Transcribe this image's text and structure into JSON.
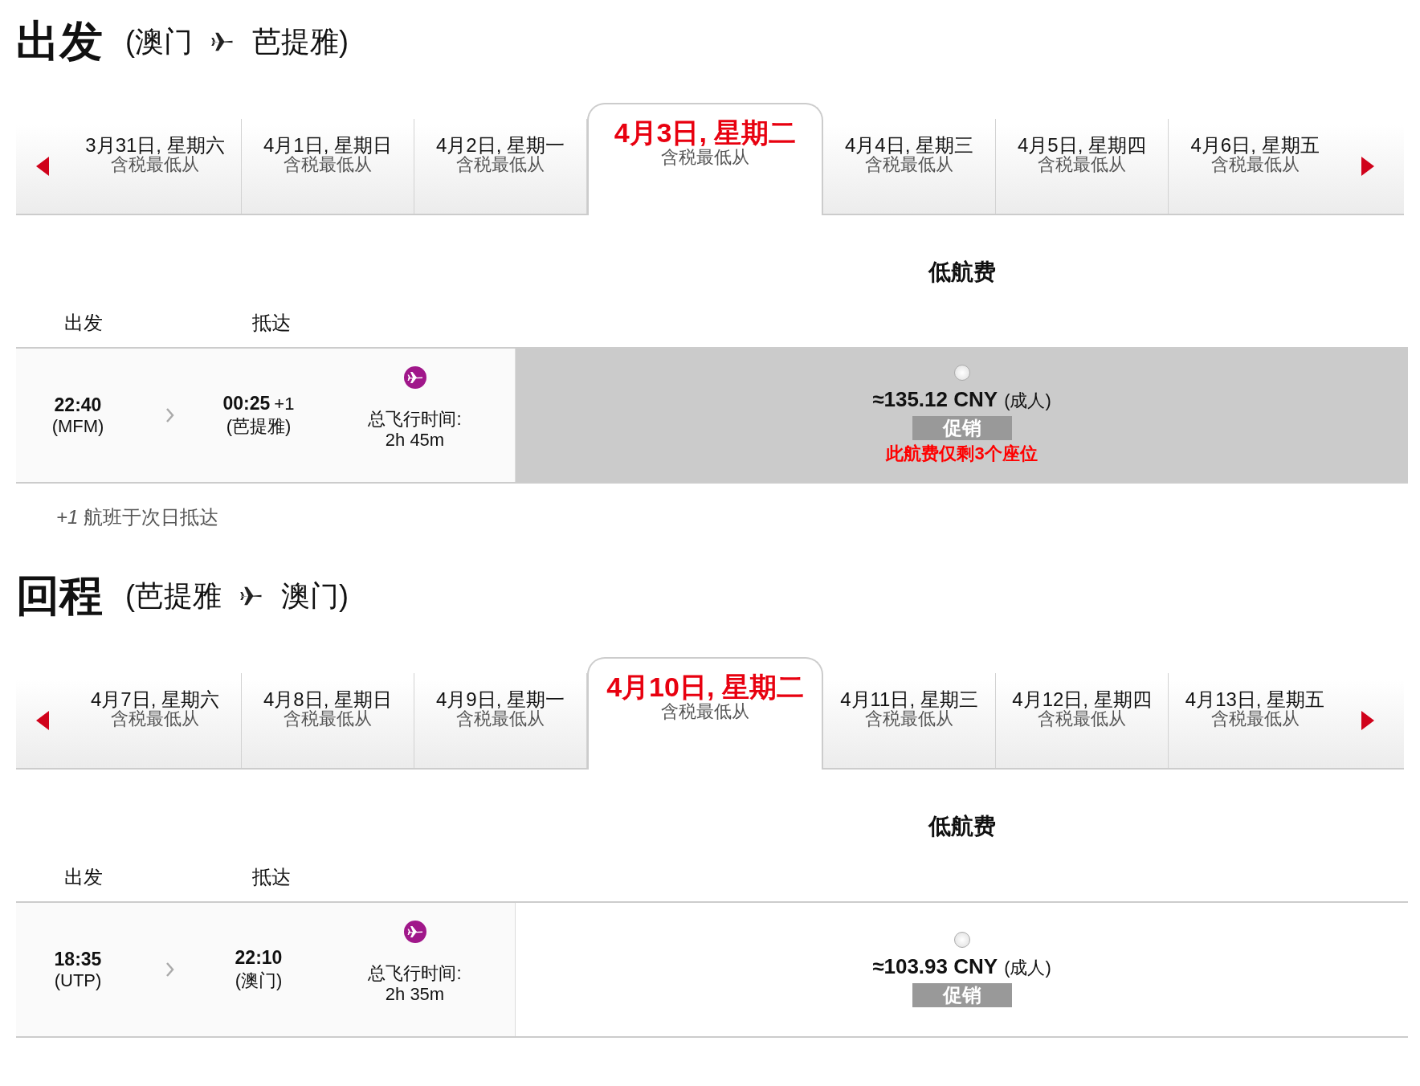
{
  "sections": [
    {
      "title": "出发",
      "route_from": "(澳门",
      "route_to": "芭提雅)",
      "dates": [
        {
          "date": "3月31日, 星期六",
          "sub": "含税最低从",
          "selected": false
        },
        {
          "date": "4月1日, 星期日",
          "sub": "含税最低从",
          "selected": false
        },
        {
          "date": "4月2日, 星期一",
          "sub": "含税最低从",
          "selected": false
        },
        {
          "date": "4月3日, 星期二",
          "sub": "含税最低从",
          "selected": true
        },
        {
          "date": "4月4日, 星期三",
          "sub": "含税最低从",
          "selected": false
        },
        {
          "date": "4月5日, 星期四",
          "sub": "含税最低从",
          "selected": false
        },
        {
          "date": "4月6日, 星期五",
          "sub": "含税最低从",
          "selected": false
        }
      ],
      "fare_header": "低航费",
      "col_depart": "出发",
      "col_arrive": "抵达",
      "flight": {
        "dep_time": "22:40",
        "dep_code": "(MFM)",
        "arr_time": "00:25",
        "arr_plus": "+1",
        "arr_place": "(芭提雅)",
        "duration_label": "总飞行时间:",
        "duration": "2h 45m",
        "fare": {
          "price": "≈135.12 CNY",
          "pax": "(成人)",
          "badge": "促销",
          "warning": "此航费仅剩3个座位",
          "highlighted": true,
          "checked": false
        }
      },
      "note": {
        "mark": "+1",
        "text": "航班于次日抵达"
      }
    },
    {
      "title": "回程",
      "route_from": "(芭提雅",
      "route_to": "澳门)",
      "dates": [
        {
          "date": "4月7日, 星期六",
          "sub": "含税最低从",
          "selected": false
        },
        {
          "date": "4月8日, 星期日",
          "sub": "含税最低从",
          "selected": false
        },
        {
          "date": "4月9日, 星期一",
          "sub": "含税最低从",
          "selected": false
        },
        {
          "date": "4月10日, 星期二",
          "sub": "含税最低从",
          "selected": true
        },
        {
          "date": "4月11日, 星期三",
          "sub": "含税最低从",
          "selected": false
        },
        {
          "date": "4月12日, 星期四",
          "sub": "含税最低从",
          "selected": false
        },
        {
          "date": "4月13日, 星期五",
          "sub": "含税最低从",
          "selected": false
        }
      ],
      "fare_header": "低航费",
      "col_depart": "出发",
      "col_arrive": "抵达",
      "flight": {
        "dep_time": "18:35",
        "dep_code": "(UTP)",
        "arr_time": "22:10",
        "arr_place": "(澳门)",
        "duration_label": "总飞行时间:",
        "duration": "2h 35m",
        "fare": {
          "price": "≈103.93 CNY",
          "pax": "(成人)",
          "badge": "促销",
          "highlighted": false,
          "checked": false
        }
      }
    }
  ]
}
